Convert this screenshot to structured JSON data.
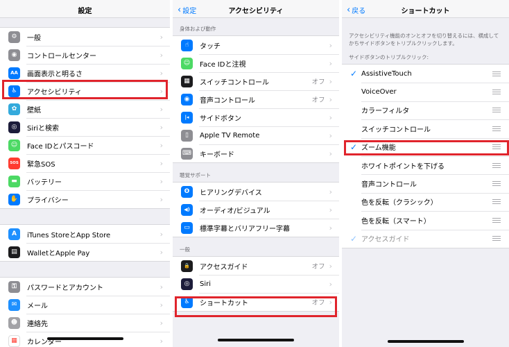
{
  "colors": {
    "blue": "#007aff",
    "highlight": "#e0242c",
    "gray_icon": "#8e8e93",
    "green_icon": "#4cd964",
    "red_icon": "#ff3b30",
    "orange_icon": "#ff9500"
  },
  "settings": {
    "title": "設定",
    "groups": [
      [
        {
          "label": "一般",
          "icon": "gear-icon",
          "color": "#8e8e93",
          "glyph": "⚙"
        },
        {
          "label": "コントロールセンター",
          "icon": "toggles-icon",
          "color": "#8e8e93",
          "glyph": "◉"
        },
        {
          "label": "画面表示と明るさ",
          "icon": "text-size-icon",
          "color": "#007aff",
          "glyph": "AA"
        },
        {
          "label": "アクセシビリティ",
          "icon": "accessibility-icon",
          "color": "#007aff",
          "glyph": "♿"
        },
        {
          "label": "壁紙",
          "icon": "flower-icon",
          "color": "#34aadc",
          "glyph": "✿"
        },
        {
          "label": "Siriと検索",
          "icon": "siri-icon",
          "color": "#1c1c3a",
          "glyph": "◎"
        },
        {
          "label": "Face IDとパスコード",
          "icon": "face-id-icon",
          "color": "#4cd964",
          "glyph": "☺"
        },
        {
          "label": "緊急SOS",
          "icon": "sos-icon",
          "color": "#ff3b30",
          "glyph": "SOS"
        },
        {
          "label": "バッテリー",
          "icon": "battery-icon",
          "color": "#4cd964",
          "glyph": "▬"
        },
        {
          "label": "プライバシー",
          "icon": "hand-icon",
          "color": "#007aff",
          "glyph": "✋"
        }
      ],
      [
        {
          "label": "iTunes StoreとApp Store",
          "icon": "app-store-icon",
          "color": "#1e90ff",
          "glyph": "A"
        },
        {
          "label": "WalletとApple Pay",
          "icon": "wallet-icon",
          "color": "#1c1c1e",
          "glyph": "▤"
        }
      ],
      [
        {
          "label": "パスワードとアカウント",
          "icon": "key-icon",
          "color": "#8e8e93",
          "glyph": "⚿"
        },
        {
          "label": "メール",
          "icon": "mail-icon",
          "color": "#1e90ff",
          "glyph": "✉"
        },
        {
          "label": "連絡先",
          "icon": "contacts-icon",
          "color": "#a2a2a6",
          "glyph": "☻"
        },
        {
          "label": "カレンダー",
          "icon": "calendar-icon",
          "color": "#ffffff",
          "glyph": "▦"
        }
      ]
    ]
  },
  "accessibility": {
    "back_label": "設定",
    "title": "アクセシビリティ",
    "sections": [
      {
        "header": "身体および動作",
        "rows": [
          {
            "label": "タッチ",
            "value": "",
            "icon": "touch-hand-icon",
            "color": "#007aff",
            "glyph": "☝"
          },
          {
            "label": "Face IDと注視",
            "value": "",
            "icon": "face-id-icon",
            "color": "#4cd964",
            "glyph": "☺"
          },
          {
            "label": "スイッチコントロール",
            "value": "オフ",
            "icon": "switch-grid-icon",
            "color": "#1c1c1e",
            "glyph": "▦"
          },
          {
            "label": "音声コントロール",
            "value": "オフ",
            "icon": "voice-control-icon",
            "color": "#007aff",
            "glyph": "◉"
          },
          {
            "label": "サイドボタン",
            "value": "",
            "icon": "side-button-icon",
            "color": "#007aff",
            "glyph": "|◂"
          },
          {
            "label": "Apple TV Remote",
            "value": "",
            "icon": "remote-icon",
            "color": "#8e8e93",
            "glyph": "▯"
          },
          {
            "label": "キーボード",
            "value": "",
            "icon": "keyboard-icon",
            "color": "#8e8e93",
            "glyph": "⌨"
          }
        ]
      },
      {
        "header": "聴覚サポート",
        "rows": [
          {
            "label": "ヒアリングデバイス",
            "value": "",
            "icon": "ear-icon",
            "color": "#007aff",
            "glyph": "ʘ"
          },
          {
            "label": "オーディオ/ビジュアル",
            "value": "",
            "icon": "speaker-icon",
            "color": "#007aff",
            "glyph": "◀)"
          },
          {
            "label": "標準字幕とバリアフリー字幕",
            "value": "",
            "icon": "captions-icon",
            "color": "#007aff",
            "glyph": "▭"
          }
        ]
      },
      {
        "header": "一般",
        "rows": [
          {
            "label": "アクセスガイド",
            "value": "オフ",
            "icon": "lock-icon",
            "color": "#1c1c1e",
            "glyph": "🔒"
          },
          {
            "label": "Siri",
            "value": "",
            "icon": "siri-icon",
            "color": "#1c1c3a",
            "glyph": "◎"
          },
          {
            "label": "ショートカット",
            "value": "オフ",
            "icon": "accessibility-icon",
            "color": "#007aff",
            "glyph": "♿"
          }
        ]
      }
    ]
  },
  "shortcut": {
    "back_label": "戻る",
    "title": "ショートカット",
    "description": "アクセシビリティ機能のオンとオフを切り替えるには、横成してかちサイドボタンをトリプルクリックします。",
    "header": "サイドボタンのトリプルクリック:",
    "items": [
      {
        "label": "AssistiveTouch",
        "checked": true,
        "dim": false
      },
      {
        "label": "VoiceOver",
        "checked": false,
        "dim": false
      },
      {
        "label": "カラーフィルタ",
        "checked": false,
        "dim": false
      },
      {
        "label": "スイッチコントロール",
        "checked": false,
        "dim": false
      },
      {
        "label": "ズーム機能",
        "checked": true,
        "dim": false
      },
      {
        "label": "ホワイトポイントを下げる",
        "checked": false,
        "dim": false
      },
      {
        "label": "音声コントロール",
        "checked": false,
        "dim": false
      },
      {
        "label": "色を反転（クラシック）",
        "checked": false,
        "dim": false
      },
      {
        "label": "色を反転（スマート）",
        "checked": false,
        "dim": false
      },
      {
        "label": "アクセスガイド",
        "checked": true,
        "dim": true
      }
    ]
  }
}
